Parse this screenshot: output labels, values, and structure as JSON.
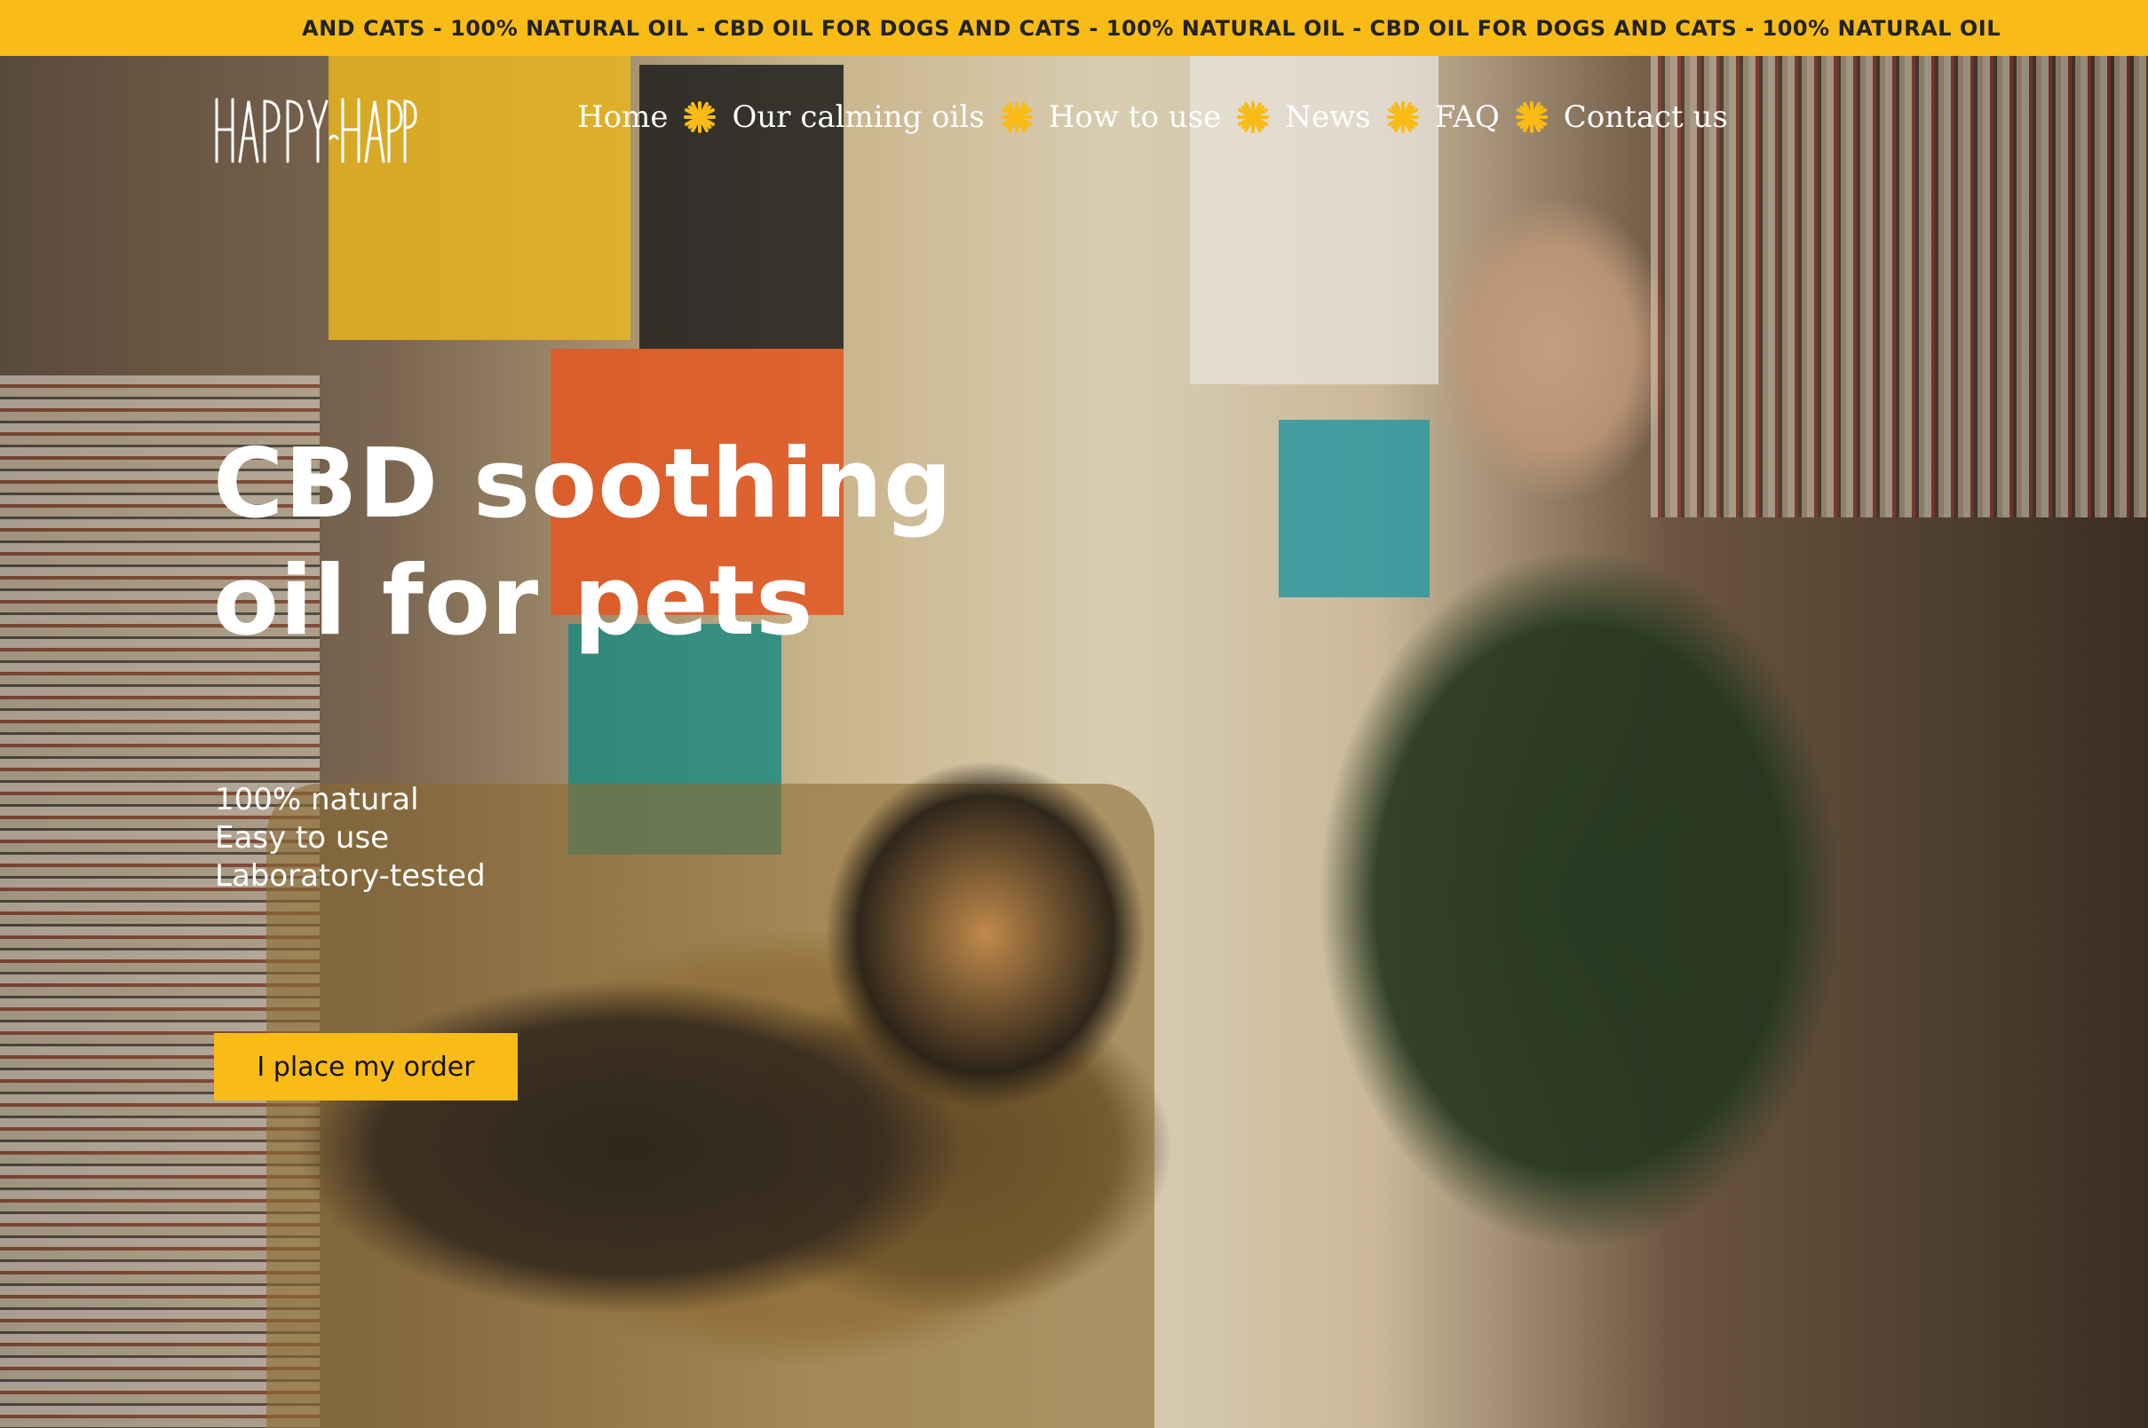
{
  "ticker": {
    "text": "AND CATS - 100% NATURAL OIL - CBD OIL FOR DOGS AND CATS - 100% NATURAL OIL - CBD OIL FOR DOGS AND CATS - 100% NATURAL OIL"
  },
  "brand": {
    "logo_text": "HAPPY-HAPPY",
    "accent_color": "#f9bb16"
  },
  "nav": {
    "items": [
      {
        "label": "Home"
      },
      {
        "label": "Our calming oils"
      },
      {
        "label": "How to use"
      },
      {
        "label": "News"
      },
      {
        "label": "FAQ"
      },
      {
        "label": "Contact us"
      }
    ],
    "separator_icon": "sun-flower-icon"
  },
  "hero": {
    "headline_line1": "CBD soothing",
    "headline_line2": "oil for pets",
    "features": [
      "100% natural",
      "Easy to use",
      "Laboratory-tested"
    ],
    "cta_label": "I place my order",
    "image_icon": "photo-man-with-dog"
  }
}
